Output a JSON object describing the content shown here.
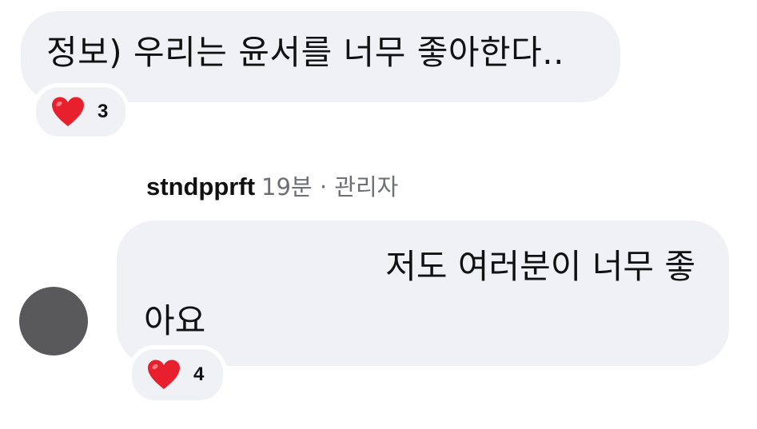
{
  "comment": {
    "text": "정보) 우리는 윤서를 너무 좋아한다..",
    "reaction": {
      "icon": "heart-icon",
      "color": "#e8202e",
      "count": "3"
    }
  },
  "reply": {
    "username": "stndpprft",
    "meta": "19분 · 관리자",
    "text_line1": "저도 여러분이 너무 좋",
    "text_line2": "아요",
    "avatar_color": "#59595b",
    "reaction": {
      "icon": "heart-icon",
      "color": "#e8202e",
      "count": "4"
    }
  },
  "colors": {
    "bubble": "#f0f1f4",
    "meta_text": "#6e6f75"
  }
}
